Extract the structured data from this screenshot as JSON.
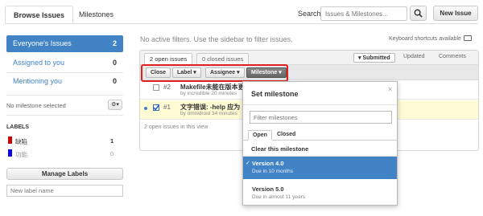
{
  "header": {
    "tabs": [
      "Browse Issues",
      "Milestones"
    ],
    "search_label": "Search:",
    "search_placeholder": "Issues & Milestones...",
    "new_issue": "New Issue"
  },
  "sidebar": {
    "items": [
      {
        "label": "Everyone's Issues",
        "count": "2"
      },
      {
        "label": "Assigned to you",
        "count": "0"
      },
      {
        "label": "Mentioning you",
        "count": "0"
      }
    ],
    "milestone_label": "No milestone selected",
    "labels_heading": "LABELS",
    "labels": [
      {
        "name": "缺陷",
        "count": "1",
        "color": "#cc0000"
      },
      {
        "name": "功能",
        "count": "0",
        "color": "#0b02e1"
      }
    ],
    "manage_labels": "Manage Labels",
    "new_label_placeholder": "New label name"
  },
  "main": {
    "notice": "No active filters. Use the sidebar to filter issues.",
    "shortcuts": "Keyboard shortcuts available",
    "subtabs": [
      "2 open issues",
      "0 closed issues"
    ],
    "sort": [
      "Submitted",
      "Updated",
      "Comments"
    ],
    "actions": [
      "Close",
      "Label",
      "Assignee",
      "Milestone"
    ],
    "issues": [
      {
        "number": "#2",
        "title": "Makefile未能在版本更",
        "meta": "by incredible 20 minutes",
        "checked": false
      },
      {
        "number": "#1",
        "title": "文字错误: -help 应为",
        "meta": "by omnidroid 34 minutes",
        "checked": true
      }
    ],
    "footer": "2 open issues in this view"
  },
  "popup": {
    "title": "Set milestone",
    "close": "×",
    "filter_placeholder": "Filter milestones",
    "tabs": [
      "Open",
      "Closed"
    ],
    "clear": "Clear this milestone",
    "milestones": [
      {
        "name": "Version 4.0",
        "due": "Due in 10 months",
        "selected": true,
        "check": "✓"
      },
      {
        "name": "Version 5.0",
        "due": "Due in almost 11 years",
        "selected": false
      }
    ]
  },
  "colors": {
    "accent": "#4183c4",
    "highlight_row": "#fffbd5",
    "selected_row": "#4183c4",
    "red_box": "#e02020"
  }
}
